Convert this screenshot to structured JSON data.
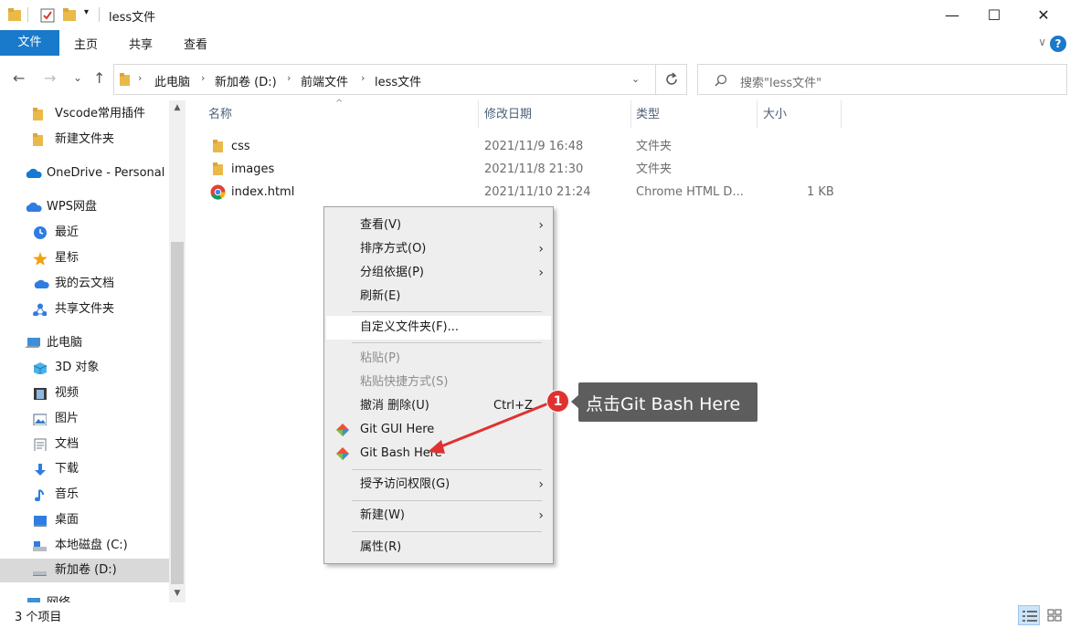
{
  "window": {
    "title": "less文件",
    "minimize_label": "—",
    "maximize_label": "☐",
    "close_label": "✕"
  },
  "ribbon": {
    "tabs": [
      "文件",
      "主页",
      "共享",
      "查看"
    ],
    "help": "?",
    "collapse": "∨"
  },
  "nav": {
    "back": "←",
    "forward": "→",
    "recent": "⌄",
    "up": "↑",
    "breadcrumb": [
      "此电脑",
      "新加卷 (D:)",
      "前端文件",
      "less文件"
    ],
    "search_placeholder": "搜索\"less文件\""
  },
  "sidebar": {
    "items": [
      {
        "label": "Vscode常用插件",
        "icon": "folder-icon"
      },
      {
        "label": "新建文件夹",
        "icon": "folder-icon"
      },
      {
        "label": "OneDrive - Personal",
        "icon": "cloud-icon"
      },
      {
        "label": "WPS网盘",
        "icon": "wps-cloud-icon"
      },
      {
        "label": "最近",
        "icon": "clock-icon"
      },
      {
        "label": "星标",
        "icon": "star-icon"
      },
      {
        "label": "我的云文档",
        "icon": "cloud-doc-icon"
      },
      {
        "label": "共享文件夹",
        "icon": "share-icon"
      },
      {
        "label": "此电脑",
        "icon": "computer-icon"
      },
      {
        "label": "3D 对象",
        "icon": "cube-icon"
      },
      {
        "label": "视频",
        "icon": "video-icon"
      },
      {
        "label": "图片",
        "icon": "picture-icon"
      },
      {
        "label": "文档",
        "icon": "document-icon"
      },
      {
        "label": "下载",
        "icon": "download-icon"
      },
      {
        "label": "音乐",
        "icon": "music-icon"
      },
      {
        "label": "桌面",
        "icon": "desktop-icon"
      },
      {
        "label": "本地磁盘 (C:)",
        "icon": "drive-icon"
      },
      {
        "label": "新加卷 (D:)",
        "icon": "drive-icon"
      },
      {
        "label": "网络",
        "icon": "network-icon"
      }
    ]
  },
  "files": {
    "columns": [
      "名称",
      "修改日期",
      "类型",
      "大小"
    ],
    "rows": [
      {
        "name": "css",
        "date": "2021/11/9 16:48",
        "type": "文件夹",
        "size": ""
      },
      {
        "name": "images",
        "date": "2021/11/8 21:30",
        "type": "文件夹",
        "size": ""
      },
      {
        "name": "index.html",
        "date": "2021/11/10 21:24",
        "type": "Chrome HTML D...",
        "size": "1 KB"
      }
    ]
  },
  "status": {
    "count": "3 个项目"
  },
  "context_menu": {
    "items": [
      {
        "label": "查看(V)",
        "submenu": true
      },
      {
        "label": "排序方式(O)",
        "submenu": true
      },
      {
        "label": "分组依据(P)",
        "submenu": true
      },
      {
        "label": "刷新(E)"
      },
      {
        "label": "自定义文件夹(F)..."
      },
      {
        "label": "粘贴(P)",
        "disabled": true
      },
      {
        "label": "粘贴快捷方式(S)",
        "disabled": true
      },
      {
        "label": "撤消 删除(U)",
        "accel": "Ctrl+Z"
      },
      {
        "label": "Git GUI Here"
      },
      {
        "label": "Git Bash Here"
      },
      {
        "label": "授予访问权限(G)",
        "submenu": true
      },
      {
        "label": "新建(W)",
        "submenu": true
      },
      {
        "label": "属性(R)"
      }
    ]
  },
  "annotation": {
    "step": "1",
    "text": "点击Git Bash Here",
    "colors": {
      "badge": "#e03131",
      "bubble": "#5d5d5d"
    }
  }
}
